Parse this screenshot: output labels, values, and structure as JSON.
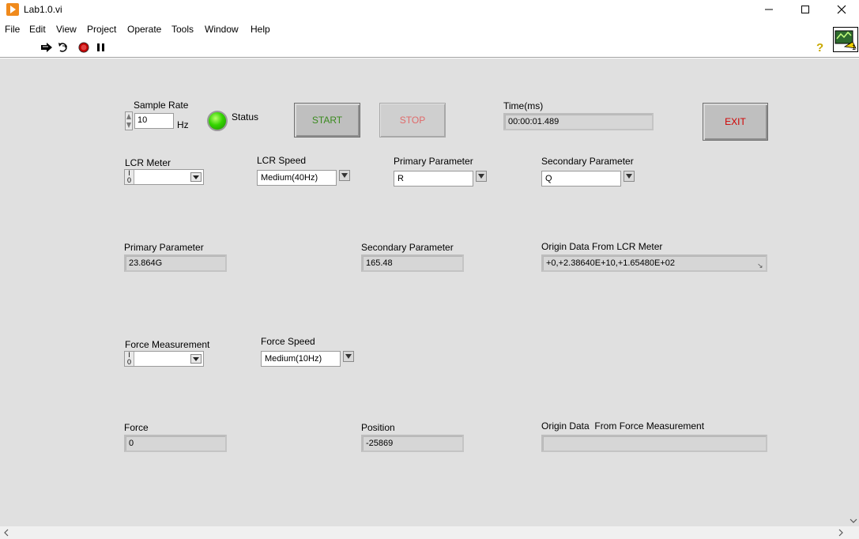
{
  "window": {
    "title": "Lab1.0.vi",
    "controls": {
      "minimize": "minimize",
      "maximize": "maximize",
      "close": "close"
    }
  },
  "menu": [
    "File",
    "Edit",
    "View",
    "Project",
    "Operate",
    "Tools",
    "Window",
    "Help"
  ],
  "toolbar": {
    "icons": [
      "run-arrow-icon",
      "run-continuously-icon",
      "abort-icon",
      "pause-icon"
    ],
    "help_icon": "?",
    "vi_icon_badge": "1"
  },
  "panel": {
    "sample_rate": {
      "label": "Sample Rate",
      "value": "10",
      "unit": "Hz"
    },
    "status": {
      "label": "Status",
      "led_color": "#33d400"
    },
    "start_button": {
      "label": "START",
      "color": "#3a8a1e"
    },
    "stop_button": {
      "label": "STOP",
      "color": "#e06a6a"
    },
    "time": {
      "label": "Time(ms)",
      "value": "00:00:01.489"
    },
    "exit_button": {
      "label": "EXIT",
      "color": "#d10000"
    },
    "lcr_meter": {
      "label": "LCR Meter",
      "value": ""
    },
    "lcr_speed": {
      "label": "LCR Speed",
      "value": "Medium(40Hz)"
    },
    "primary_param_select": {
      "label": "Primary Parameter",
      "value": "R"
    },
    "secondary_param_select": {
      "label": "Secondary Parameter",
      "value": "Q"
    },
    "primary_param_display": {
      "label": "Primary Parameter",
      "value": "23.864G"
    },
    "secondary_param_display": {
      "label": "Secondary Parameter",
      "value": "165.48"
    },
    "origin_lcr": {
      "label": "Origin Data From LCR Meter",
      "value": "+0,+2.38640E+10,+1.65480E+02"
    },
    "force_measurement": {
      "label": "Force Measurement",
      "value": ""
    },
    "force_speed": {
      "label": "Force Speed",
      "value": "Medium(10Hz)"
    },
    "force": {
      "label": "Force",
      "value": "0"
    },
    "position": {
      "label": "Position",
      "value": "-25869"
    },
    "origin_force": {
      "label": "Origin Data  From Force Measurement",
      "value": ""
    }
  },
  "colors": {
    "panel_bg": "#e0e0e0",
    "indicator_bg": "#d6d6d6"
  }
}
